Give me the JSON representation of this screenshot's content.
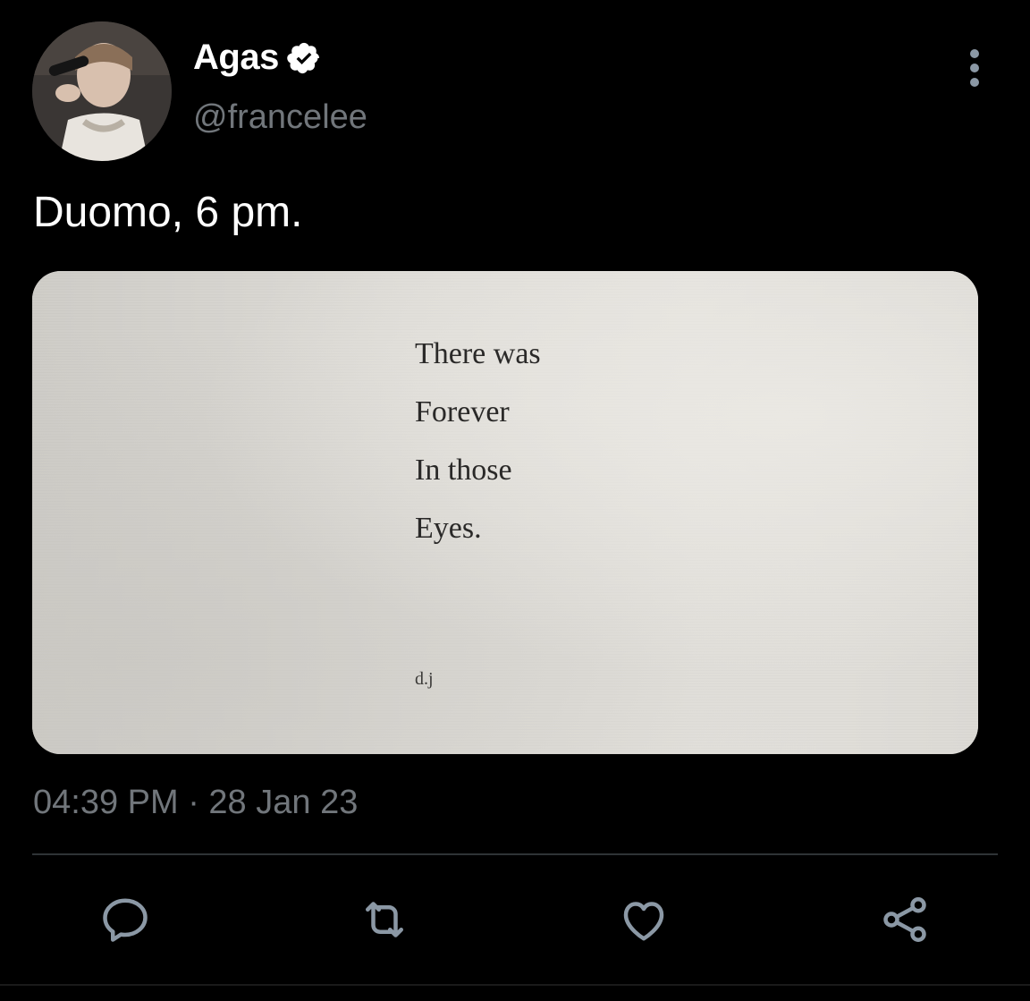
{
  "tweet": {
    "display_name": "Agas",
    "handle": "@francelee",
    "text": "Duomo, 6 pm.",
    "timestamp": "04:39 PM · 28 Jan 23",
    "verified": true
  },
  "media": {
    "poem_lines": [
      "There was",
      "Forever",
      "In those",
      "Eyes."
    ],
    "signature": "d.j"
  },
  "icons": {
    "verified": "verified-badge-icon",
    "more": "more-vertical-icon",
    "reply": "reply-icon",
    "retweet": "retweet-icon",
    "like": "heart-icon",
    "share": "share-icon"
  },
  "colors": {
    "background": "#000000",
    "primary_text": "#ffffff",
    "secondary_text": "#71767b",
    "divider": "#2f3336",
    "icon": "#8b98a5"
  }
}
